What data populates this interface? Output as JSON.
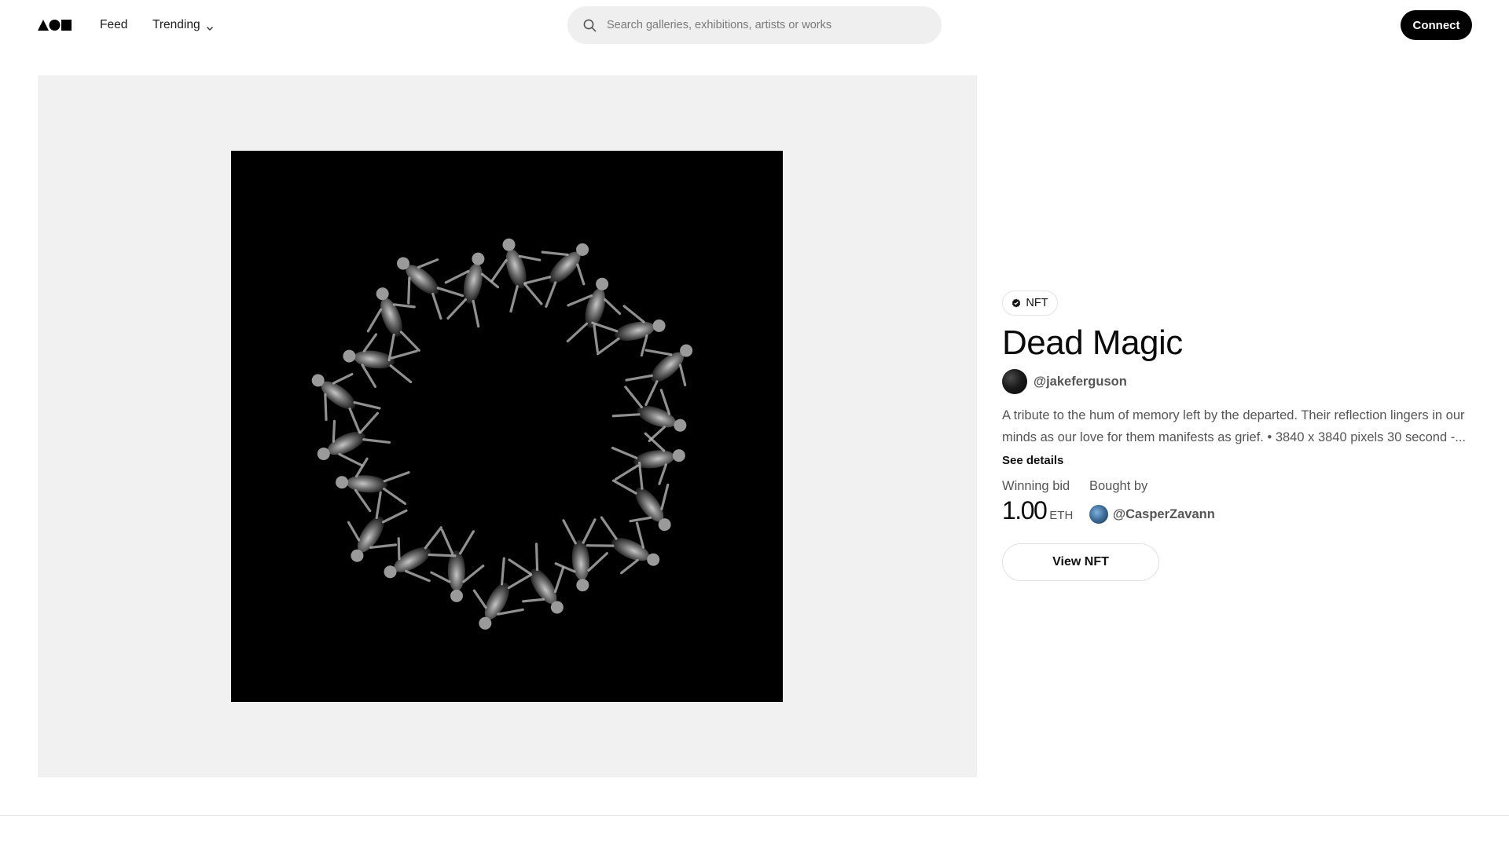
{
  "nav": {
    "feed_label": "Feed",
    "trending_label": "Trending",
    "search_placeholder": "Search galleries, exhibitions, artists or works",
    "connect_label": "Connect"
  },
  "artwork": {
    "badge_label": "NFT",
    "title": "Dead Magic",
    "artist_handle": "@jakeferguson",
    "description": "A tribute to the hum of memory left by the departed. Their reflection lingers in our minds as our love for them manifests as grief. • 3840 x 3840 pixels 30 second -...",
    "see_details_label": "See details"
  },
  "sale": {
    "winning_bid_label": "Winning bid",
    "amount": "1.00",
    "currency": "ETH",
    "bought_by_label": "Bought by",
    "buyer_handle": "@CasperZavann",
    "view_button_label": "View NFT"
  },
  "icons": {
    "logo": "aoi-logo",
    "trending": "chevron-down-icon",
    "search": "search-icon",
    "badge": "verified-icon"
  },
  "colors": {
    "primary_button": "#000000",
    "art_panel_bg": "#f1f1f1",
    "search_bg": "#efefef",
    "muted_text": "#555555"
  }
}
